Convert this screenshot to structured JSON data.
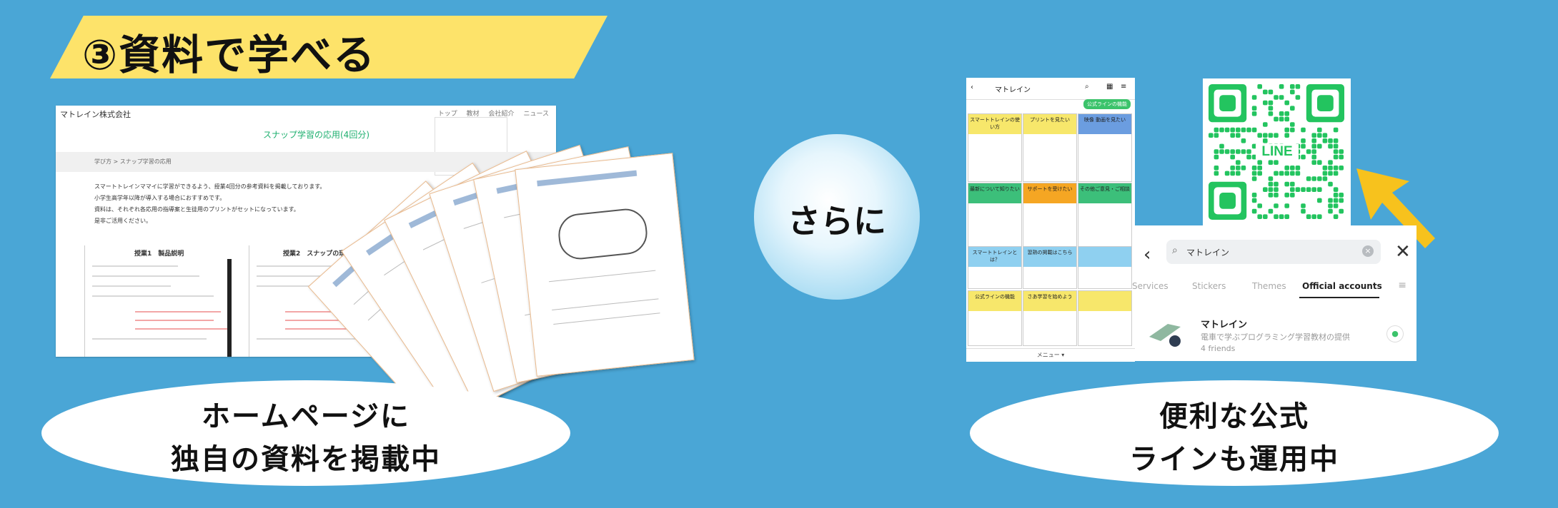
{
  "title": "③資料で学べる",
  "website": {
    "company": "マトレイン株式会社",
    "nav": [
      "トップ",
      "教材",
      "会社紹介",
      "ニュース"
    ],
    "page_title": "スナップ学習の応用(4回分)",
    "breadcrumb": "学び方 > スナップ学習の応用",
    "paragraphs": [
      "スマートトレインママイに学習ができるよう、授業4回分の参考資料を掲載しております。",
      "小学生高学年以降が導入する場合におすすめです。",
      "資料は、それぞれ各応用の指導案と生徒用のプリントがセットになっています。",
      "是非ご活用ください。"
    ],
    "lesson1_title": "授業1　製品説明",
    "lesson2_title": "授業2　スナップの理解"
  },
  "circle_text": "さらに",
  "oval_left": {
    "line1": "ホームページに",
    "line2": "独自の資料を掲載中"
  },
  "oval_right": {
    "line1": "便利な公式",
    "line2": "ラインも運用中"
  },
  "line_phone": {
    "account_name": "マトレイン",
    "menu_tag": "公式ラインの機能",
    "tiles": [
      "スマートトレインの使い方",
      "プリントを見たい",
      "映像 動画を見たい",
      "最新について知りたい",
      "サポートを受けたい",
      "その他ご意見・ご相談",
      "スマートトレインとは？",
      "習熟の掲載はこちら",
      "",
      "公式ラインの機能",
      "さあ学習を始めよう",
      ""
    ],
    "bottom_menu": "メニュー ▾"
  },
  "line_search": {
    "query": "マトレイン",
    "tabs": [
      "Services",
      "Stickers",
      "Themes",
      "Official accounts"
    ],
    "active_tab": "Official accounts",
    "result_name": "マトレイン",
    "result_desc": "電車で学ぶプログラミング学習教材の提供",
    "result_friends": "4 friends"
  },
  "qr_label": "LINE",
  "colors": {
    "background": "#4aa6d6",
    "banner": "#fde36a",
    "line_green": "#23c45f",
    "arrow": "#f7c21d"
  }
}
